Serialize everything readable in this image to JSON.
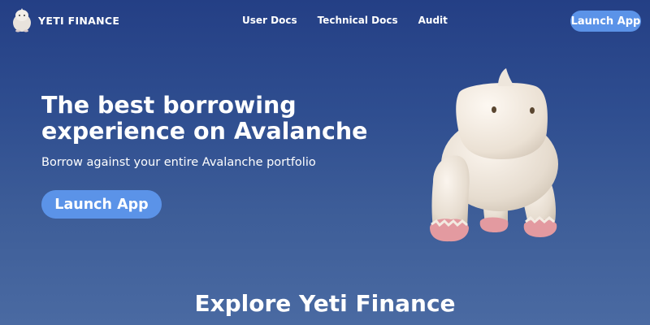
{
  "brand": {
    "name": "YETI FINANCE",
    "logo_icon": "yeti-logo-icon"
  },
  "nav": {
    "links": [
      "User Docs",
      "Technical Docs",
      "Audit"
    ],
    "cta_label": "Launch App"
  },
  "hero": {
    "title": "The best borrowing experience on Avalanche",
    "subtitle": "Borrow against your entire Avalanche portfolio",
    "cta_label": "Launch App",
    "illustration": "yeti-mascot-illustration"
  },
  "section": {
    "heading": "Explore Yeti Finance"
  },
  "colors": {
    "background_top": "#243f85",
    "background_bottom": "#4a6aa2",
    "button": "#5b93e8",
    "text": "#ffffff",
    "mascot_body": "#ede3d6",
    "mascot_feet": "#e39aa0"
  }
}
